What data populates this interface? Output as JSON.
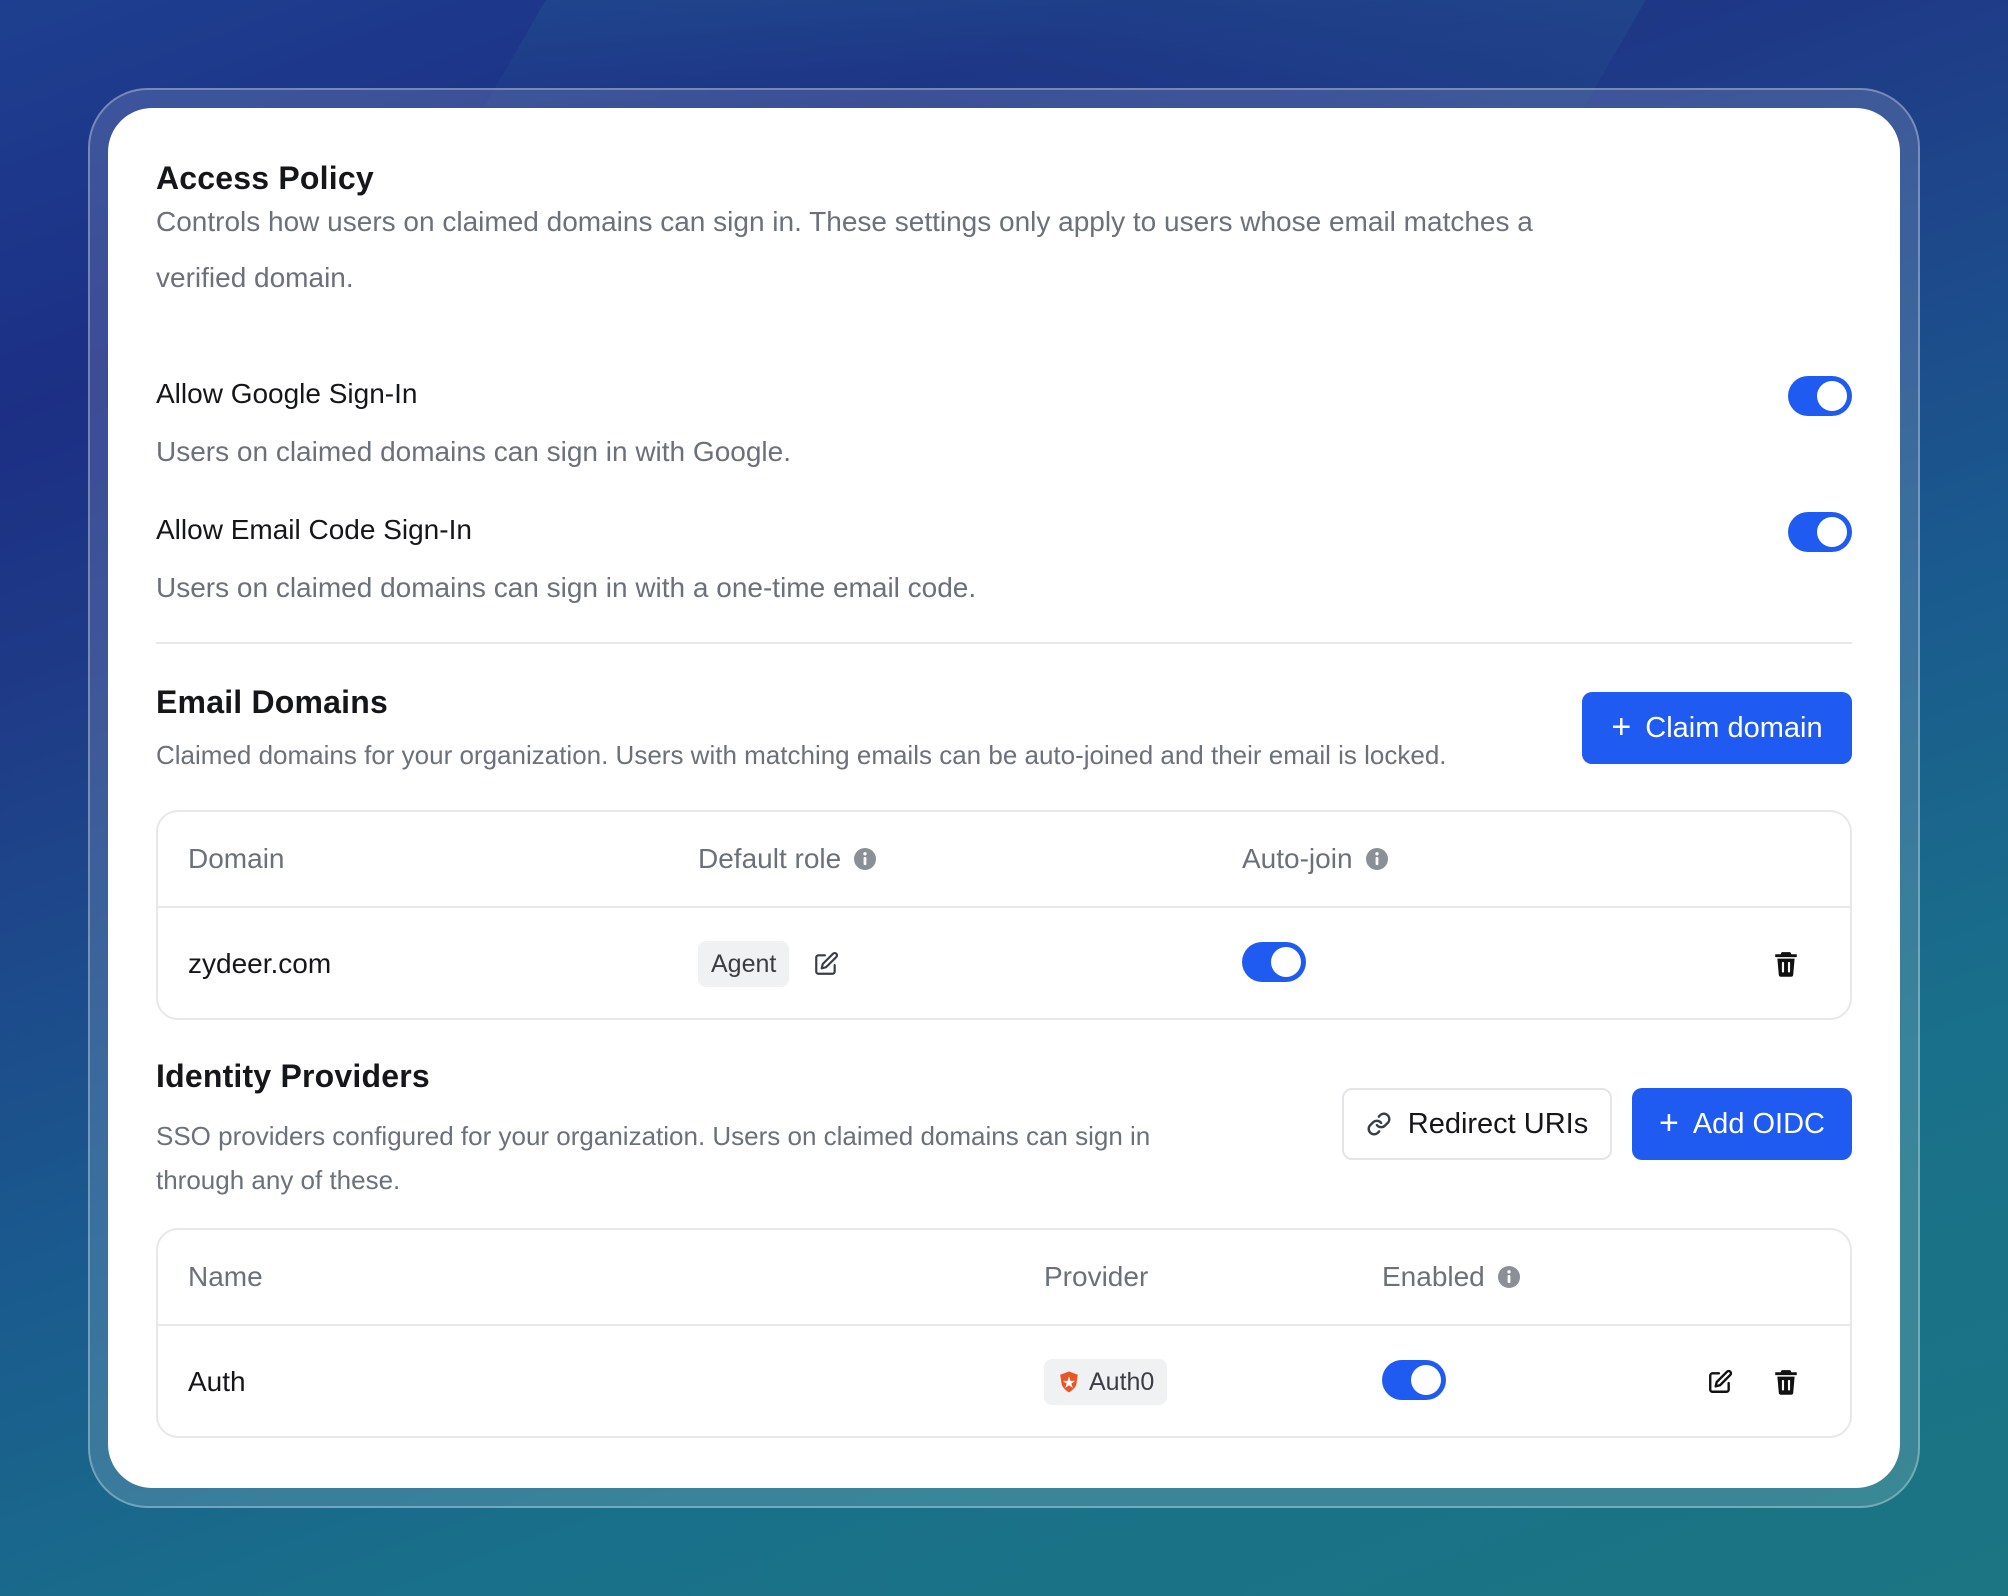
{
  "access_policy": {
    "title": "Access Policy",
    "description_line1": "Controls how users on claimed domains can sign in. These settings only apply to users whose email matches a",
    "description_line2": "verified domain.",
    "google": {
      "label": "Allow Google Sign-In",
      "description": "Users on claimed domains can sign in with Google.",
      "enabled": true
    },
    "email_code": {
      "label": "Allow Email Code Sign-In",
      "description": "Users on claimed domains can sign in with a one-time email code.",
      "enabled": true
    }
  },
  "email_domains": {
    "title": "Email Domains",
    "description": "Claimed domains for your organization. Users with matching emails can be auto-joined and their email is locked.",
    "claim_button": "Claim domain",
    "columns": {
      "domain": "Domain",
      "default_role": "Default role",
      "auto_join": "Auto-join"
    },
    "rows": [
      {
        "domain": "zydeer.com",
        "role": "Agent",
        "auto_join": true
      }
    ]
  },
  "identity_providers": {
    "title": "Identity Providers",
    "description_line1": "SSO providers configured for your organization. Users on claimed domains can sign in",
    "description_line2": "through any of these.",
    "redirect_button": "Redirect URIs",
    "add_button": "Add OIDC",
    "columns": {
      "name": "Name",
      "provider": "Provider",
      "enabled": "Enabled"
    },
    "rows": [
      {
        "name": "Auth",
        "provider": "Auth0",
        "enabled": true
      }
    ]
  },
  "colors": {
    "accent": "#1f5bf1",
    "auth0_brand": "#eb5424"
  }
}
